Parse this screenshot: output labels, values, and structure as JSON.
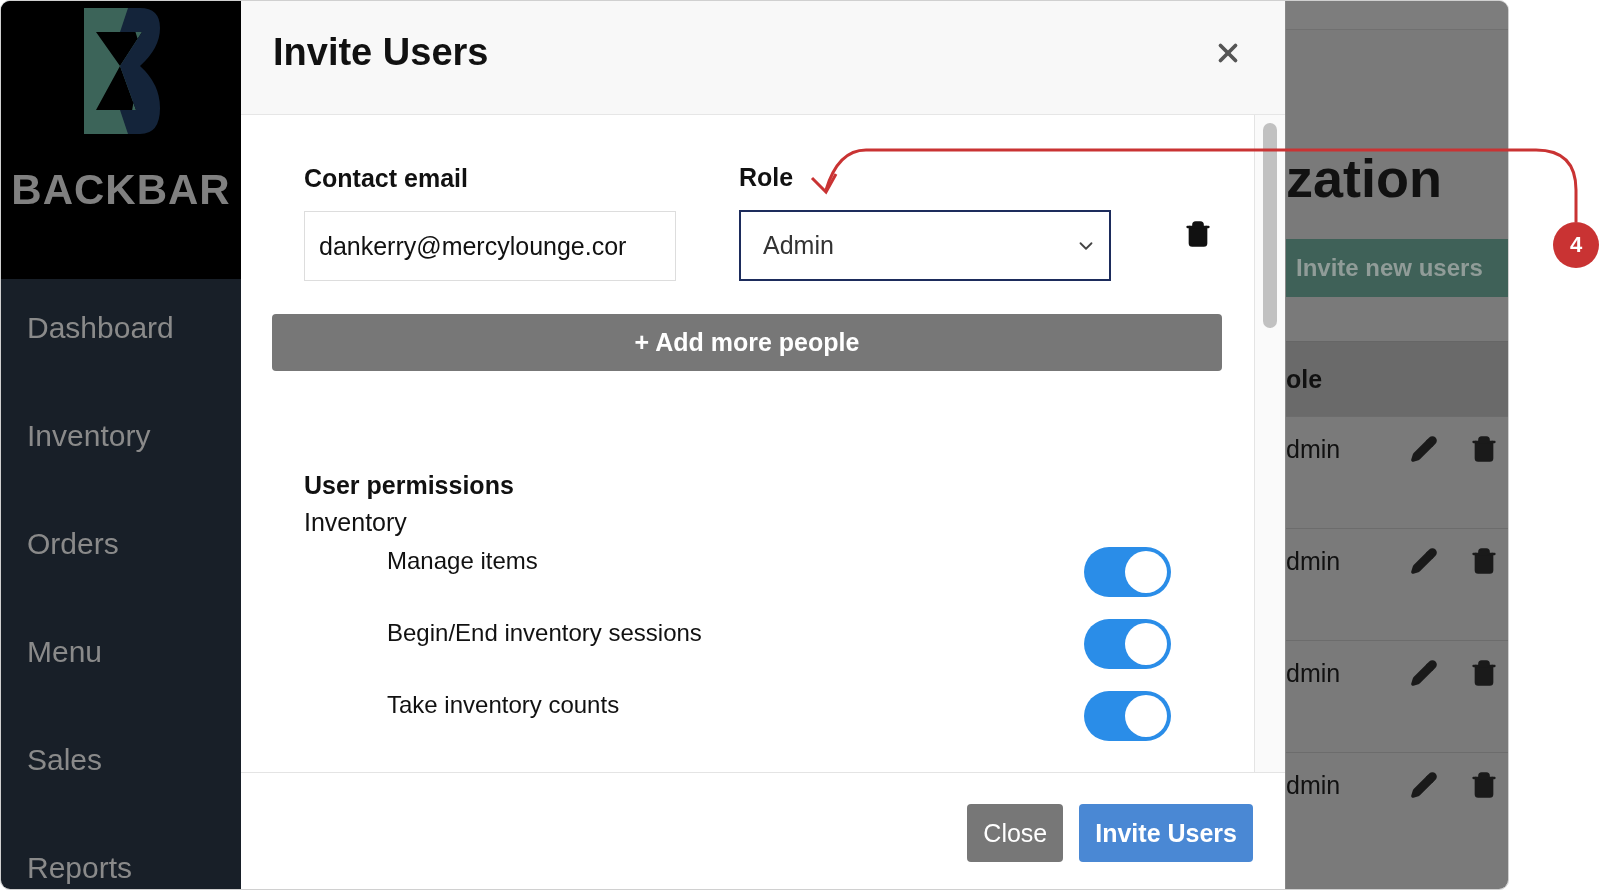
{
  "sidebar": {
    "brand": "BACKBAR",
    "nav": [
      {
        "label": "Dashboard"
      },
      {
        "label": "Inventory"
      },
      {
        "label": "Orders"
      },
      {
        "label": "Menu"
      },
      {
        "label": "Sales"
      },
      {
        "label": "Reports"
      }
    ]
  },
  "background_page": {
    "title": "zation",
    "invite_button": "Invite new users",
    "table": {
      "columns": [
        "ole"
      ],
      "rows": [
        {
          "role": "dmin"
        },
        {
          "role": "dmin"
        },
        {
          "role": "dmin"
        },
        {
          "role": "dmin"
        }
      ]
    }
  },
  "modal": {
    "title": "Invite Users",
    "invitees": [
      {
        "email_label": "Contact email",
        "email": "dankerry@mercylounge.cor",
        "role_label": "Role",
        "role": "Admin"
      }
    ],
    "add_button": "+ Add more people",
    "permissions": {
      "heading": "User permissions",
      "groups": [
        {
          "label": "Inventory",
          "items": [
            {
              "label": "Manage items",
              "on": true
            },
            {
              "label": "Begin/End inventory sessions",
              "on": true
            },
            {
              "label": "Take inventory counts",
              "on": true
            }
          ]
        }
      ]
    },
    "footer_buttons": [
      {
        "label": "Close",
        "kind": "secondary"
      },
      {
        "label": "Invite Users",
        "kind": "primary"
      }
    ]
  },
  "annotation": {
    "number": "4"
  }
}
